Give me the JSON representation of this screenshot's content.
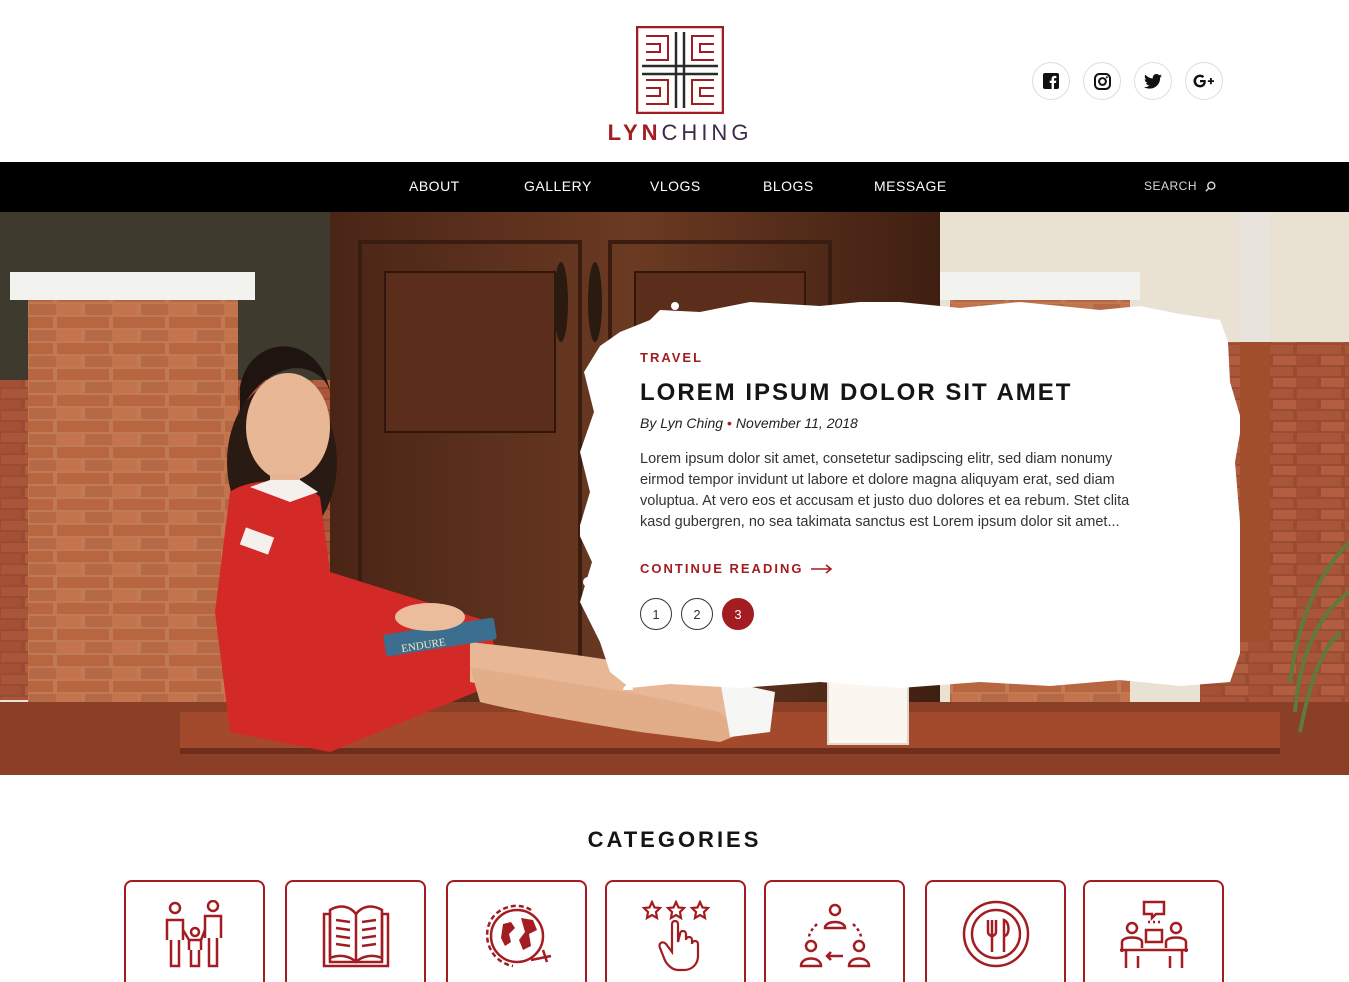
{
  "brand": {
    "lyn": "LYN",
    "ching": "CHING",
    "primary_color": "#a31c22",
    "secondary_color": "#3c2a4a"
  },
  "social": [
    {
      "name": "facebook-icon"
    },
    {
      "name": "instagram-icon"
    },
    {
      "name": "twitter-icon"
    },
    {
      "name": "google-plus-icon"
    }
  ],
  "nav": {
    "items": [
      "ABOUT",
      "GALLERY",
      "VLOGS",
      "BLOGS",
      "MESSAGE"
    ],
    "search_label": "SEARCH"
  },
  "hero": {
    "tag": "TRAVEL",
    "title": "LOREM IPSUM DOLOR SIT AMET",
    "author": "By Lyn Ching",
    "date": "November 11, 2018",
    "excerpt": "Lorem ipsum dolor sit amet, consetetur sadipscing elitr, sed diam nonumy eirmod tempor invidunt ut labore et dolore magna aliquyam erat, sed diam voluptua. At vero eos et accusam et justo duo dolores et ea rebum. Stet clita kasd gubergren, no sea takimata sanctus est Lorem ipsum dolor sit amet...",
    "continue_label": "CONTINUE READING",
    "book_title": "ENDURE",
    "pages": [
      "1",
      "2",
      "3"
    ],
    "active_page": "3"
  },
  "categories": {
    "title": "CATEGORIES",
    "items": [
      {
        "icon": "family-icon"
      },
      {
        "icon": "book-icon"
      },
      {
        "icon": "travel-globe-icon"
      },
      {
        "icon": "rating-stars-icon"
      },
      {
        "icon": "community-icon"
      },
      {
        "icon": "food-plate-icon"
      },
      {
        "icon": "conversation-icon"
      }
    ]
  }
}
